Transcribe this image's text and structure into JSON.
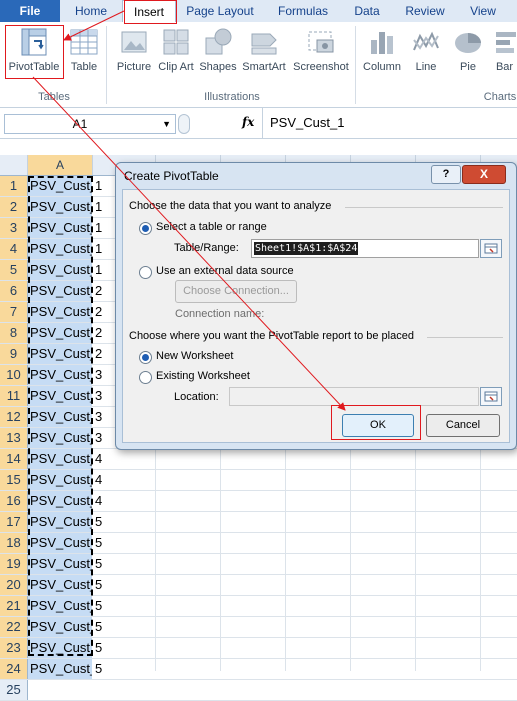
{
  "tabs": [
    "File",
    "Home",
    "Insert",
    "Page Layout",
    "Formulas",
    "Data",
    "Review",
    "View"
  ],
  "ribbon": {
    "tables_group": "Tables",
    "illustrations_group": "Illustrations",
    "charts_group": "Charts",
    "pivot_table": "PivotTable",
    "table": "Table",
    "picture": "Picture",
    "clip_art": "Clip Art",
    "shapes": "Shapes",
    "smartart": "SmartArt",
    "screenshot": "Screenshot",
    "column": "Column",
    "line": "Line",
    "pie": "Pie",
    "bar": "Bar"
  },
  "formula_bar": {
    "name_box": "A1",
    "fx": "fx",
    "content": "PSV_Cust_1"
  },
  "grid": {
    "column_headers": [
      "A",
      "",
      "",
      "",
      "",
      "",
      "",
      ""
    ],
    "rows": [
      {
        "n": "1",
        "a": "PSV_Cust_",
        "b": "1"
      },
      {
        "n": "2",
        "a": "PSV_Cust_",
        "b": "1"
      },
      {
        "n": "3",
        "a": "PSV_Cust_",
        "b": "1"
      },
      {
        "n": "4",
        "a": "PSV_Cust_",
        "b": "1"
      },
      {
        "n": "5",
        "a": "PSV_Cust_",
        "b": "1"
      },
      {
        "n": "6",
        "a": "PSV_Cust_",
        "b": "2"
      },
      {
        "n": "7",
        "a": "PSV_Cust_",
        "b": "2"
      },
      {
        "n": "8",
        "a": "PSV_Cust_",
        "b": "2"
      },
      {
        "n": "9",
        "a": "PSV_Cust_",
        "b": "2"
      },
      {
        "n": "10",
        "a": "PSV_Cust_",
        "b": "3"
      },
      {
        "n": "11",
        "a": "PSV_Cust_",
        "b": "3"
      },
      {
        "n": "12",
        "a": "PSV_Cust_",
        "b": "3"
      },
      {
        "n": "13",
        "a": "PSV_Cust_",
        "b": "3"
      },
      {
        "n": "14",
        "a": "PSV_Cust_",
        "b": "4"
      },
      {
        "n": "15",
        "a": "PSV_Cust_",
        "b": "4"
      },
      {
        "n": "16",
        "a": "PSV_Cust_",
        "b": "4"
      },
      {
        "n": "17",
        "a": "PSV_Cust_",
        "b": "5"
      },
      {
        "n": "18",
        "a": "PSV_Cust_",
        "b": "5"
      },
      {
        "n": "19",
        "a": "PSV_Cust_",
        "b": "5"
      },
      {
        "n": "20",
        "a": "PSV_Cust_",
        "b": "5"
      },
      {
        "n": "21",
        "a": "PSV_Cust_",
        "b": "5"
      },
      {
        "n": "22",
        "a": "PSV_Cust_",
        "b": "5"
      },
      {
        "n": "23",
        "a": "PSV_Cust_",
        "b": "5"
      },
      {
        "n": "24",
        "a": "PSV_Cust_",
        "b": "5"
      },
      {
        "n": "25",
        "a": "",
        "b": ""
      }
    ]
  },
  "dialog": {
    "title": "Create PivotTable",
    "help": "?",
    "close": "X",
    "section1": "Choose the data that you want to analyze",
    "select_range": "Select a table or range",
    "table_range_label": "Table/Range:",
    "table_range_value": "Sheet1!$A$1:$A$24",
    "external_source": "Use an external data source",
    "choose_connection": "Choose Connection...",
    "connection_name": "Connection name:",
    "section2": "Choose where you want the PivotTable report to be placed",
    "new_worksheet": "New Worksheet",
    "existing_worksheet": "Existing Worksheet",
    "location_label": "Location:",
    "ok": "OK",
    "cancel": "Cancel"
  },
  "colors": {
    "annotation_red": "#e0191e",
    "selection_fill": "#c6dcf4",
    "row_header_selected": "#f9d99b"
  }
}
